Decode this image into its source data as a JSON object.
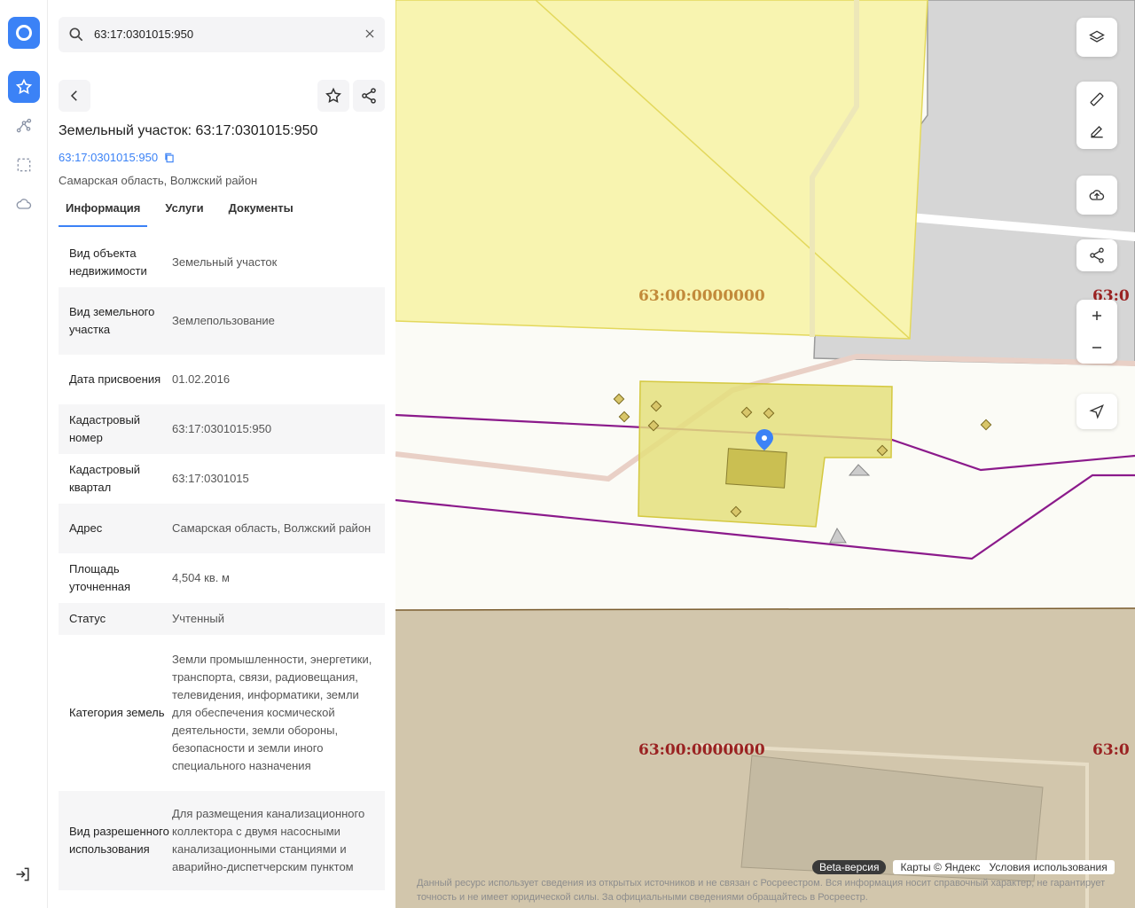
{
  "search": {
    "value": "63:17:0301015:950"
  },
  "card": {
    "title": "Земельный участок: 63:17:0301015:950",
    "cad_link": "63:17:0301015:950",
    "region": "Самарская область, Волжский район"
  },
  "tabs": [
    {
      "label": "Информация"
    },
    {
      "label": "Услуги"
    },
    {
      "label": "Документы"
    }
  ],
  "rows": [
    {
      "k": "Вид объекта недвижимости",
      "v": "Земельный участок"
    },
    {
      "k": "Вид земельного участка",
      "v": "Землепользование"
    },
    {
      "k": "Дата присвоения",
      "v": "01.02.2016"
    },
    {
      "k": "Кадастровый номер",
      "v": "63:17:0301015:950"
    },
    {
      "k": "Кадастровый квартал",
      "v": "63:17:0301015"
    },
    {
      "k": "Адрес",
      "v": "Самарская область, Волжский район"
    },
    {
      "k": "Площадь уточненная",
      "v": "4,504 кв. м"
    },
    {
      "k": "Статус",
      "v": "Учтенный"
    },
    {
      "k": "Категория земель",
      "v": "Земли промышленности, энергетики, транспорта, связи, радиовещания, телевидения, информатики, земли для обеспечения космической деятельности, земли обороны, безопасности и земли иного специального назначения"
    },
    {
      "k": "Вид разрешенного использования",
      "v": "Для размещения канализационного коллектора с двумя насосными канализационными станциями и аварийно-диспетчерским пунктом"
    }
  ],
  "map": {
    "quarter_labels": [
      "63:00:0000000",
      "63:0",
      "63:00:0000000",
      "63:0"
    ],
    "beta": "Beta-версия",
    "attribution": "Карты © Яндекс",
    "terms": "Условия использования",
    "disclaimer": "Данный ресурс использует сведения из открытых источников и не связан с Росреестром. Вся информация носит справочный характер, не гарантирует точность и не имеет юридической силы. За официальными сведениями обращайтесь в Росреестр.",
    "colors": {
      "parcel": "#e4df7c",
      "zone": "#f8f4b0",
      "line": "#8b1a8b",
      "ground": "#d2c6ac"
    }
  }
}
